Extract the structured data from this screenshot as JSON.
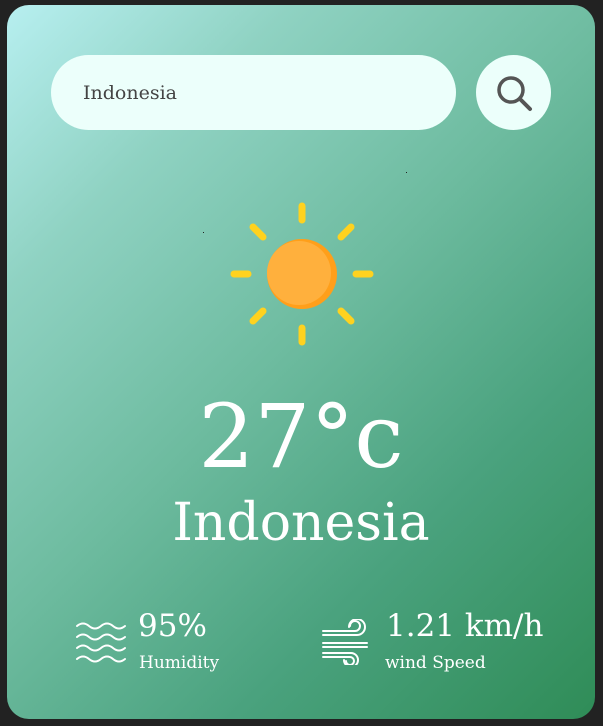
{
  "search": {
    "value": "Indonesia",
    "button_icon": "search-icon"
  },
  "weather": {
    "icon": "sun-icon",
    "temperature": "27°c",
    "city": "Indonesia"
  },
  "humidity": {
    "icon": "humidity-waves-icon",
    "value": "95%",
    "label": "Humidity"
  },
  "wind": {
    "icon": "wind-icon",
    "value": "1.21 km/h",
    "label": "wind Speed"
  },
  "colors": {
    "page_background": "#222222",
    "card_gradient_start": "#b7eff0",
    "card_gradient_end": "#2f8c57",
    "search_background": "#ecfffb",
    "sun_ray": "#ffd21f",
    "sun_core": "#ffad33",
    "text": "#ffffff"
  }
}
